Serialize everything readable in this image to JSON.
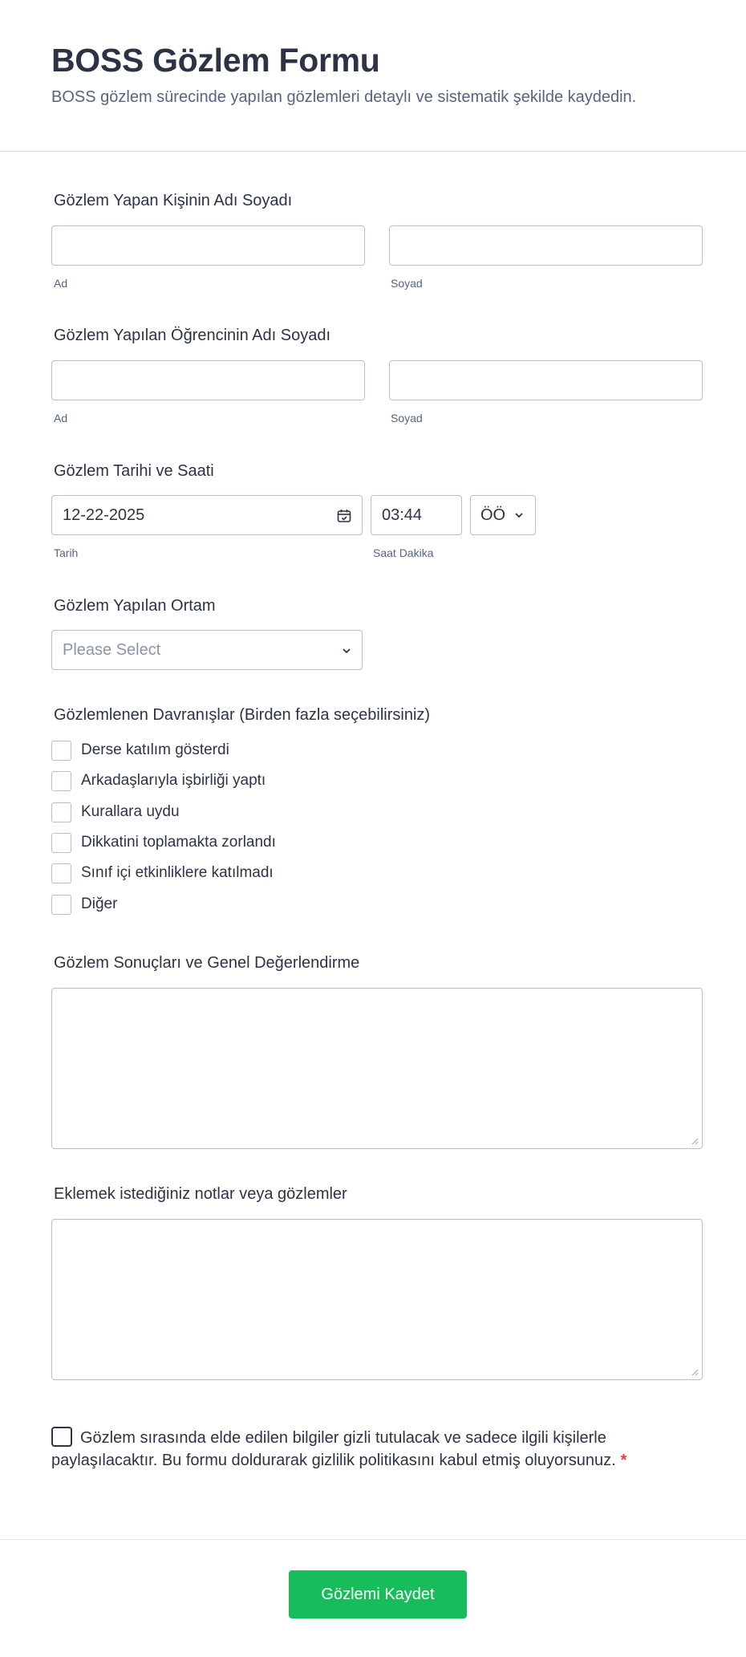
{
  "header": {
    "title": "BOSS Gözlem Formu",
    "subtitle": "BOSS gözlem sürecinde yapılan gözlemleri detaylı ve sistematik şekilde kaydedin."
  },
  "observer": {
    "label": "Gözlem Yapan Kişinin Adı Soyadı",
    "first_sublabel": "Ad",
    "last_sublabel": "Soyad",
    "first_value": "",
    "last_value": ""
  },
  "student": {
    "label": "Gözlem Yapılan Öğrencinin Adı Soyadı",
    "first_sublabel": "Ad",
    "last_sublabel": "Soyad",
    "first_value": "",
    "last_value": ""
  },
  "datetime": {
    "label": "Gözlem Tarihi ve Saati",
    "date_value": "12-22-2025",
    "date_sublabel": "Tarih",
    "time_value": "03:44",
    "time_sublabel": "Saat Dakika",
    "ampm_value": "ÖÖ"
  },
  "environment": {
    "label": "Gözlem Yapılan Ortam",
    "placeholder": "Please Select"
  },
  "behaviors": {
    "label": "Gözlemlenen Davranışlar (Birden fazla seçebilirsiniz)",
    "options": [
      "Derse katılım gösterdi",
      "Arkadaşlarıyla işbirliği yaptı",
      "Kurallara uydu",
      "Dikkatini toplamakta zorlandı",
      "Sınıf içi etkinliklere katılmadı",
      "Diğer"
    ]
  },
  "results": {
    "label": "Gözlem Sonuçları ve Genel Değerlendirme",
    "value": ""
  },
  "notes": {
    "label": "Eklemek istediğiniz notlar veya gözlemler",
    "value": ""
  },
  "consent": {
    "text": "Gözlem sırasında elde edilen bilgiler gizli tutulacak ve sadece ilgili kişilerle paylaşılacaktır. Bu formu doldurarak gizlilik politikasını kabul etmiş oluyorsunuz.",
    "required_mark": "*"
  },
  "submit": {
    "label": "Gözlemi Kaydet"
  },
  "colors": {
    "text": "#2c3345",
    "muted": "#57647e",
    "border": "#b8bdc9",
    "submit": "#18bd5b",
    "required": "#f23a3c"
  },
  "icons": {
    "calendar": "calendar-icon",
    "chevron": "chevron-down-icon",
    "resize": "resize-handle-icon"
  }
}
